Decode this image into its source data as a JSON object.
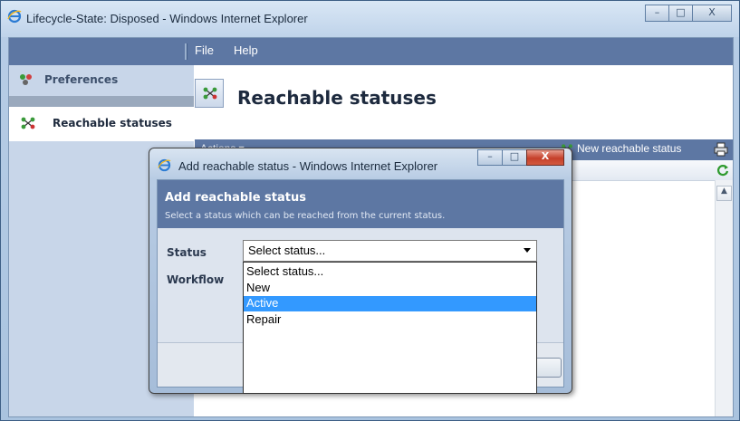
{
  "window": {
    "title": "Lifecycle-State: Disposed - Windows Internet Explorer",
    "minimize_glyph": "–",
    "maximize_glyph": "□",
    "close_glyph": "X"
  },
  "menubar": {
    "items": [
      {
        "label": "File"
      },
      {
        "label": "Help"
      }
    ]
  },
  "sidebar": {
    "items": [
      {
        "label": "Preferences",
        "icon": "preferences-icon"
      },
      {
        "label": "Reachable statuses",
        "icon": "reachable-statuses-icon",
        "selected": true
      }
    ]
  },
  "page": {
    "title": "Reachable statuses",
    "icon": "reachable-statuses-icon"
  },
  "toolbar": {
    "actions_label": "Actions ▾",
    "new_status_label": "New reachable status",
    "print_icon": "print-icon",
    "refresh_icon": "refresh-icon"
  },
  "dialog": {
    "title": "Add reachable status - Windows Internet Explorer",
    "heading": "Add reachable status",
    "subheading": "Select a status which can be reached from the current status.",
    "minimize_glyph": "–",
    "maximize_glyph": "□",
    "close_glyph": "X",
    "fields": {
      "status_label": "Status",
      "workflow_label": "Workflow"
    },
    "status_select": {
      "value": "Select status...",
      "options": [
        "Select status...",
        "New",
        "Active",
        "Repair"
      ],
      "highlighted": "Active"
    }
  },
  "colors": {
    "header_blue": "#5d77a3",
    "highlight": "#3399ff"
  }
}
